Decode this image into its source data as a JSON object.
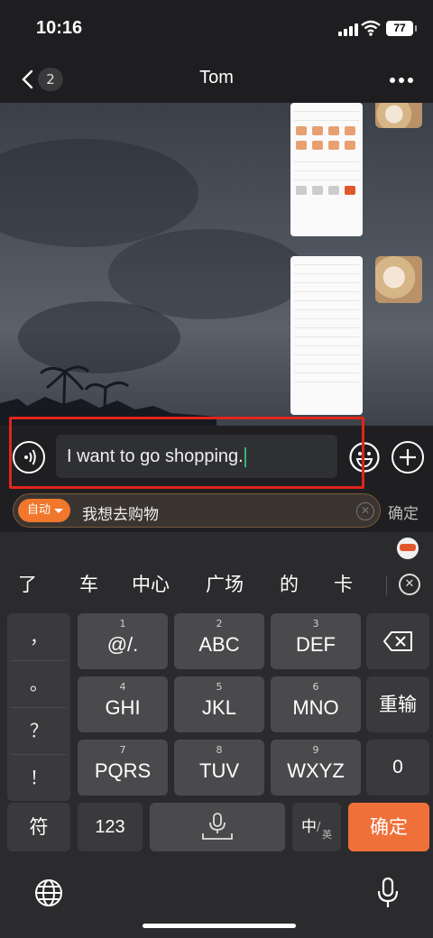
{
  "status_bar": {
    "time": "10:16",
    "battery": "77"
  },
  "nav": {
    "unread_count": "2",
    "title": "Tom"
  },
  "composer": {
    "text": "I want to go shopping."
  },
  "translation": {
    "mode": "自动",
    "text": "我想去购物",
    "confirm_label": "确定"
  },
  "keyboard": {
    "candidates": [
      "了",
      "车",
      "中心",
      "广场",
      "的",
      "卡"
    ],
    "punctuation": [
      "，",
      "。",
      "？",
      "！"
    ],
    "rows": [
      [
        {
          "num": "1",
          "label": "@/."
        },
        {
          "num": "2",
          "label": "ABC"
        },
        {
          "num": "3",
          "label": "DEF"
        }
      ],
      [
        {
          "num": "4",
          "label": "GHI"
        },
        {
          "num": "5",
          "label": "JKL"
        },
        {
          "num": "6",
          "label": "MNO"
        }
      ],
      [
        {
          "num": "7",
          "label": "PQRS"
        },
        {
          "num": "8",
          "label": "TUV"
        },
        {
          "num": "9",
          "label": "WXYZ"
        }
      ]
    ],
    "retype_label": "重输",
    "zero_label": "0",
    "symbol_label": "符",
    "numbers_label": "123",
    "lang_main": "中",
    "lang_sub": "英",
    "confirm_label": "确定"
  },
  "colors": {
    "accent": "#f0703a",
    "highlight": "#e0251b",
    "caret": "#3cb37b"
  }
}
